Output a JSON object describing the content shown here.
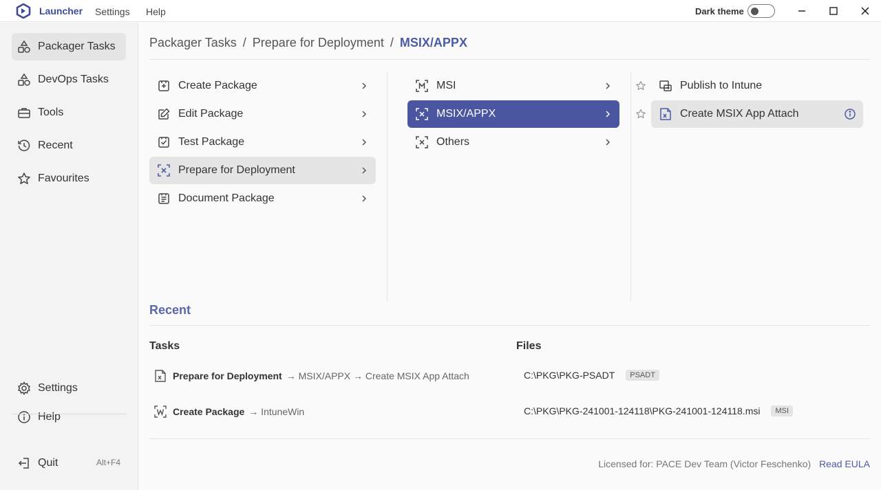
{
  "titlebar": {
    "app_name": "Launcher",
    "menu": [
      "Settings",
      "Help"
    ],
    "dark_theme_label": "Dark theme",
    "dark_theme_on": false
  },
  "sidebar": {
    "items": [
      {
        "label": "Packager Tasks",
        "icon": "shapes-icon",
        "active": true
      },
      {
        "label": "DevOps Tasks",
        "icon": "shapes-icon",
        "active": false
      },
      {
        "label": "Tools",
        "icon": "toolbox-icon",
        "active": false
      },
      {
        "label": "Recent",
        "icon": "history-icon",
        "active": false
      },
      {
        "label": "Favourites",
        "icon": "star-icon",
        "active": false
      }
    ],
    "bottom": [
      {
        "label": "Settings",
        "icon": "gear-icon"
      },
      {
        "label": "Help",
        "icon": "info-icon"
      }
    ],
    "quit_label": "Quit",
    "quit_shortcut": "Alt+F4"
  },
  "breadcrumb": {
    "parts": [
      "Packager Tasks",
      "Prepare for Deployment"
    ],
    "separator": "/",
    "current": "MSIX/APPX"
  },
  "column1": [
    {
      "label": "Create Package",
      "icon": "package-add-icon"
    },
    {
      "label": "Edit Package",
      "icon": "edit-icon"
    },
    {
      "label": "Test Package",
      "icon": "package-check-icon"
    },
    {
      "label": "Prepare for Deployment",
      "icon": "expand-arrows-icon"
    },
    {
      "label": "Document Package",
      "icon": "document-icon"
    }
  ],
  "column2": [
    {
      "label": "MSI",
      "icon": "msi-icon"
    },
    {
      "label": "MSIX/APPX",
      "icon": "msix-icon"
    },
    {
      "label": "Others",
      "icon": "others-icon"
    }
  ],
  "column3": [
    {
      "label": "Publish to Intune",
      "icon": "publish-icon"
    },
    {
      "label": "Create MSIX App Attach",
      "icon": "app-attach-icon"
    }
  ],
  "recent": {
    "title": "Recent",
    "tasks_label": "Tasks",
    "files_label": "Files",
    "tasks": [
      {
        "name": "Prepare for Deployment",
        "path": "→ MSIX/APPX → Create MSIX App Attach",
        "icon": "app-attach-icon"
      },
      {
        "name": "Create Package",
        "path": "→ IntuneWin",
        "icon": "intunewin-icon"
      }
    ],
    "files": [
      {
        "path": "C:\\PKG\\PKG-PSADT",
        "badge": "PSADT"
      },
      {
        "path": "C:\\PKG\\PKG-241001-124118\\PKG-241001-124118.msi",
        "badge": "MSI"
      }
    ]
  },
  "footer": {
    "license": "Licensed for: PACE Dev Team (Victor Feschenko)",
    "eula_link": "Read EULA"
  },
  "colors": {
    "accent": "#4a57a0",
    "accent_text": "#4c5ba5",
    "recent_title": "#5a67ad",
    "sidebar_bg": "#f3f3f3",
    "active_bg": "#e5e5e5"
  }
}
